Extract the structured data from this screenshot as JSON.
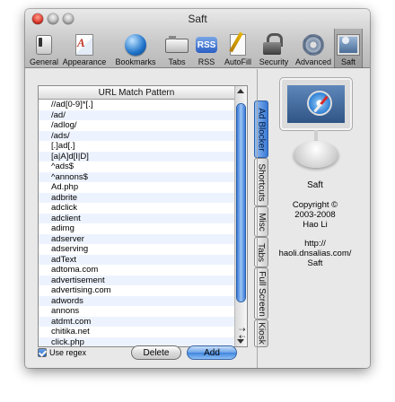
{
  "window": {
    "title": "Saft"
  },
  "toolbar": {
    "items": [
      {
        "label": "General",
        "icon": "switch-icon"
      },
      {
        "label": "Appearance",
        "icon": "font-icon"
      },
      {
        "label": "Bookmarks",
        "icon": "globe-icon"
      },
      {
        "label": "Tabs",
        "icon": "tabs-icon"
      },
      {
        "label": "RSS",
        "icon": "rss-icon"
      },
      {
        "label": "AutoFill",
        "icon": "pencil-icon"
      },
      {
        "label": "Security",
        "icon": "lock-icon"
      },
      {
        "label": "Advanced",
        "icon": "gear-icon"
      },
      {
        "label": "Saft",
        "icon": "saft-icon"
      }
    ],
    "selected": "Saft",
    "rss_badge": "RSS"
  },
  "url_list": {
    "header": "URL Match Pattern",
    "rows": [
      "//ad[0-9]*[.]",
      "/ad/",
      "/adlog/",
      "/ads/",
      "[.]ad[.]",
      "[a|A]d[I|D]",
      "^ads$",
      "^annons$",
      "Ad.php",
      "adbrite",
      "adclick",
      "adclient",
      "adimg",
      "adserver",
      "adserving",
      "adText",
      "adtoma.com",
      "advertisement",
      "advertising.com",
      "adwords",
      "annons",
      "atdmt.com",
      "chitika.net",
      "click.php"
    ]
  },
  "side_tabs": [
    "Ad Blocker",
    "Shortcuts",
    "Misc",
    "Tabs",
    "Full Screen",
    "Kiosk"
  ],
  "selected_side_tab": "Ad Blocker",
  "scroll_arrows": {
    "up": "⇢",
    "down": "⇠"
  },
  "options": {
    "use_regex_label": "Use regex",
    "use_regex_checked": true
  },
  "buttons": {
    "delete": "Delete",
    "add": "Add"
  },
  "about": {
    "app_name": "Saft",
    "copyright": "Copyright ©",
    "years": "2003-2008",
    "author": "Hao Li",
    "url_line1": "http://",
    "url_line2": "haoli.dnsalias.com/",
    "url_line3": "Saft"
  },
  "colors": {
    "accent": "#3a79d5",
    "close": "#d9291c",
    "list_stripe": "#edf3fe"
  }
}
